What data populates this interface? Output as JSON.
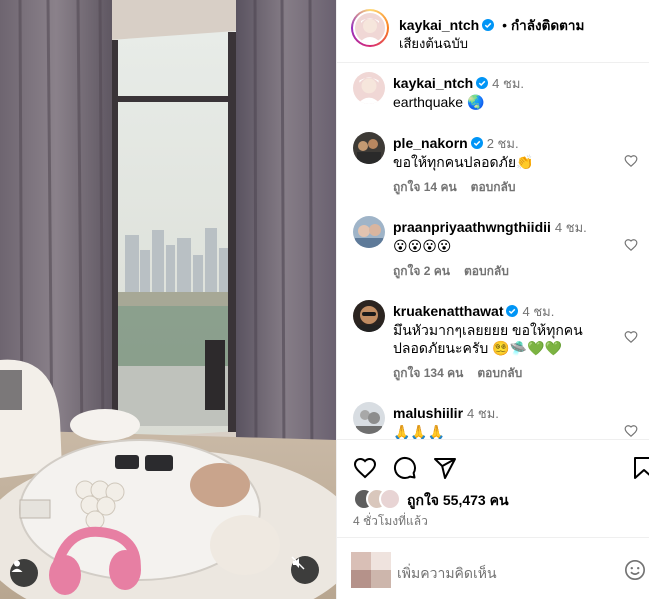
{
  "header": {
    "username": "kaykai_ntch",
    "follow_label": "กำลังติดตาม",
    "separator": "•",
    "audio_label": "เสียงต้นฉบับ"
  },
  "caption": {
    "username": "kaykai_ntch",
    "time": "4 ชม.",
    "text": "earthquake 🌏"
  },
  "comments": [
    {
      "username": "ple_nakorn",
      "verified": true,
      "time": "2 ชม.",
      "text": "ขอให้ทุกคนปลอดภัย👏",
      "likes": "ถูกใจ 14 คน",
      "reply": "ตอบกลับ"
    },
    {
      "username": "praanpriyaathwngthiidii",
      "verified": false,
      "time": "4 ชม.",
      "text": "😮😮😮😮",
      "likes": "ถูกใจ 2 คน",
      "reply": "ตอบกลับ"
    },
    {
      "username": "kruakenatthawat",
      "verified": true,
      "time": "4 ชม.",
      "text_line1": "มึนหัวมากๆเลยยยย ขอให้ทุกคน",
      "text_line2": "ปลอดภัยนะครับ 😵‍💫🛸💚💚",
      "likes": "ถูกใจ 134 คน",
      "reply": "ตอบกลับ"
    },
    {
      "username": "malushiilir",
      "verified": false,
      "time": "4 ชม.",
      "text": "🙏🙏🙏"
    }
  ],
  "footer": {
    "likes_text": "ถูกใจ 55,473 คน",
    "time_ago": "4 ชั่วโมงที่แล้ว",
    "add_comment_placeholder": "เพิ่มความคิดเห็น",
    "emoji_icon": "smiley-icon"
  },
  "colors": {
    "verified": "#0095f6",
    "muted": "#737373",
    "border": "#efefef"
  }
}
